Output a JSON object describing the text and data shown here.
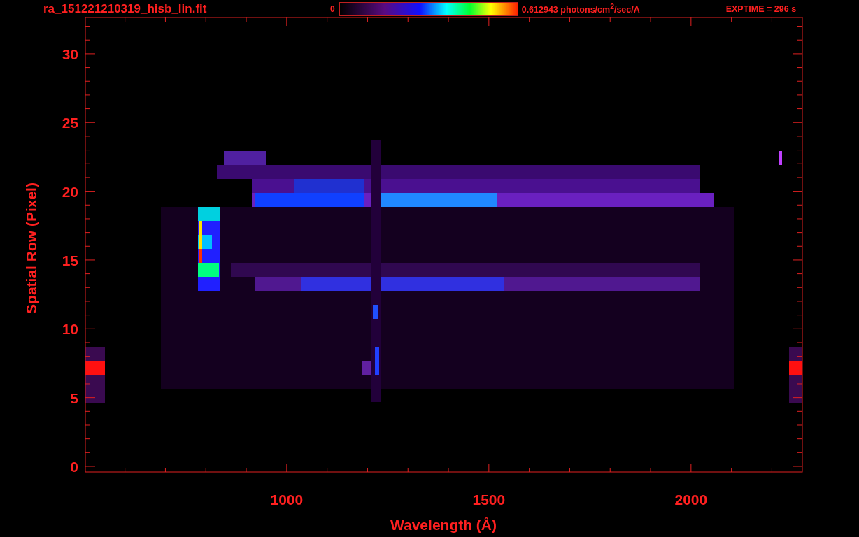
{
  "header": {
    "file_name": "ra_151221210319_hisb_lin.fit",
    "colorbar_min": "0",
    "colorbar_max": "0.612943 photons/cm$^{2}$/sec/A",
    "exposure": "EXPTIME = 296 s"
  },
  "plot": {
    "x_axis": {
      "label": "Wavelength (Å)",
      "ticks": [
        "1000",
        "1500",
        "2000"
      ]
    },
    "y_axis": {
      "label": "Spatial Row (Pixel)",
      "ticks": [
        "30",
        "25",
        "20",
        "15",
        "10",
        "5",
        "0"
      ]
    }
  }
}
